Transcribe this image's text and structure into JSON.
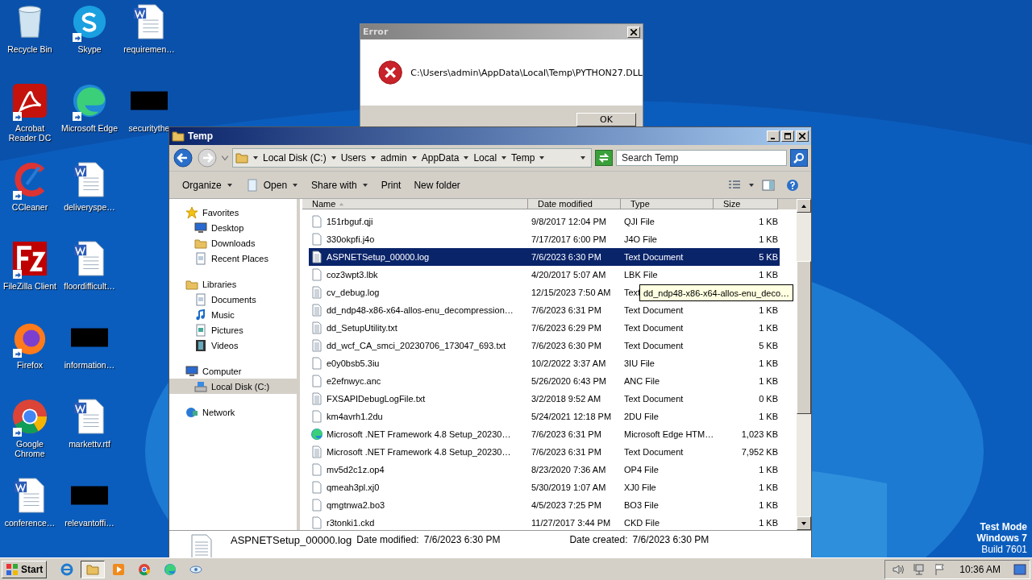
{
  "desktop_icons": [
    {
      "label": "Recycle Bin",
      "kind": "recycle",
      "shortcut": false
    },
    {
      "label": "Acrobat Reader DC",
      "kind": "acrobat",
      "shortcut": true
    },
    {
      "label": "CCleaner",
      "kind": "ccleaner",
      "shortcut": true
    },
    {
      "label": "FileZilla Client",
      "kind": "filezilla",
      "shortcut": true
    },
    {
      "label": "Firefox",
      "kind": "firefox",
      "shortcut": true
    },
    {
      "label": "Google Chrome",
      "kind": "chrome",
      "shortcut": true
    },
    {
      "label": "conference…",
      "kind": "word",
      "shortcut": false
    },
    {
      "label": "Skype",
      "kind": "skype",
      "shortcut": true
    },
    {
      "label": "Microsoft Edge",
      "kind": "edge",
      "shortcut": true
    },
    {
      "label": "deliveryspe…",
      "kind": "word",
      "shortcut": false
    },
    {
      "label": "floordifficult…",
      "kind": "word",
      "shortcut": false
    },
    {
      "label": "information…",
      "kind": "blank",
      "shortcut": false
    },
    {
      "label": "markettv.rtf",
      "kind": "word",
      "shortcut": false
    },
    {
      "label": "relevantoffi…",
      "kind": "blank",
      "shortcut": false
    },
    {
      "label": "requiremen…",
      "kind": "word",
      "shortcut": false
    },
    {
      "label": "securitythe",
      "kind": "blank",
      "shortcut": false
    }
  ],
  "error_dialog": {
    "title": "Error",
    "message": "C:\\Users\\admin\\AppData\\Local\\Temp\\PYTHON27.DLL",
    "button": "OK"
  },
  "explorer": {
    "title": "Temp",
    "breadcrumb": [
      "Local Disk (C:)",
      "Users",
      "admin",
      "AppData",
      "Local",
      "Temp"
    ],
    "search": {
      "placeholder": "Search Temp"
    },
    "toolbar": [
      {
        "label": "Organize",
        "dropdown": true
      },
      {
        "label": "Open",
        "dropdown": true
      },
      {
        "label": "Share with",
        "dropdown": true
      },
      {
        "label": "Print",
        "dropdown": false
      },
      {
        "label": "New folder",
        "dropdown": false
      }
    ],
    "nav": [
      {
        "label": "Favorites",
        "kind": "star",
        "selected": false,
        "children": [
          {
            "label": "Desktop",
            "kind": "desktop",
            "selected": false
          },
          {
            "label": "Downloads",
            "kind": "downloads",
            "selected": false
          },
          {
            "label": "Recent Places",
            "kind": "recent",
            "selected": false
          }
        ]
      },
      {
        "label": "Libraries",
        "kind": "libraries",
        "selected": false,
        "children": [
          {
            "label": "Documents",
            "kind": "documents",
            "selected": false
          },
          {
            "label": "Music",
            "kind": "music",
            "selected": false
          },
          {
            "label": "Pictures",
            "kind": "pictures",
            "selected": false
          },
          {
            "label": "Videos",
            "kind": "videos",
            "selected": false
          }
        ]
      },
      {
        "label": "Computer",
        "kind": "computer",
        "selected": false,
        "children": [
          {
            "label": "Local Disk (C:)",
            "kind": "disk",
            "selected": true
          }
        ]
      },
      {
        "label": "Network",
        "kind": "network",
        "selected": false
      }
    ],
    "columns": [
      "Name",
      "Date modified",
      "Type",
      "Size"
    ],
    "rows": [
      {
        "name": "151rbguf.qji",
        "date": "9/8/2017 12:04 PM",
        "type": "QJI File",
        "size": "1 KB",
        "kind": "file",
        "selected": false
      },
      {
        "name": "330okpfi.j4o",
        "date": "7/17/2017 6:00 PM",
        "type": "J4O File",
        "size": "1 KB",
        "kind": "file",
        "selected": false
      },
      {
        "name": "ASPNETSetup_00000.log",
        "date": "7/6/2023 6:30 PM",
        "type": "Text Document",
        "size": "5 KB",
        "kind": "text",
        "selected": true
      },
      {
        "name": "coz3wpt3.lbk",
        "date": "4/20/2017 5:07 AM",
        "type": "LBK File",
        "size": "1 KB",
        "kind": "file",
        "selected": false
      },
      {
        "name": "cv_debug.log",
        "date": "12/15/2023 7:50 AM",
        "type": "Text",
        "kind": "text",
        "selected": false
      },
      {
        "name": "dd_ndp48-x86-x64-allos-enu_decompression…",
        "date": "7/6/2023 6:31 PM",
        "type": "Text Document",
        "size": "1 KB",
        "kind": "text",
        "selected": false
      },
      {
        "name": "dd_SetupUtility.txt",
        "date": "7/6/2023 6:29 PM",
        "type": "Text Document",
        "size": "1 KB",
        "kind": "text",
        "selected": false
      },
      {
        "name": "dd_wcf_CA_smci_20230706_173047_693.txt",
        "date": "7/6/2023 6:30 PM",
        "type": "Text Document",
        "size": "5 KB",
        "kind": "text",
        "selected": false
      },
      {
        "name": "e0y0bsb5.3iu",
        "date": "10/2/2022 3:37 AM",
        "type": "3IU File",
        "size": "1 KB",
        "kind": "file",
        "selected": false
      },
      {
        "name": "e2efnwyc.anc",
        "date": "5/26/2020 6:43 PM",
        "type": "ANC File",
        "size": "1 KB",
        "kind": "file",
        "selected": false
      },
      {
        "name": "FXSAPIDebugLogFile.txt",
        "date": "3/2/2018 9:52 AM",
        "type": "Text Document",
        "size": "0 KB",
        "kind": "text",
        "selected": false
      },
      {
        "name": "km4avrh1.2du",
        "date": "5/24/2021 12:18 PM",
        "type": "2DU File",
        "size": "1 KB",
        "kind": "file",
        "selected": false
      },
      {
        "name": "Microsoft .NET Framework 4.8 Setup_20230…",
        "date": "7/6/2023 6:31 PM",
        "type": "Microsoft Edge HTM…",
        "size": "1,023 KB",
        "kind": "edge",
        "selected": false
      },
      {
        "name": "Microsoft .NET Framework 4.8 Setup_20230…",
        "date": "7/6/2023 6:31 PM",
        "type": "Text Document",
        "size": "7,952 KB",
        "kind": "text",
        "selected": false
      },
      {
        "name": "mv5d2c1z.op4",
        "date": "8/23/2020 7:36 AM",
        "type": "OP4 File",
        "size": "1 KB",
        "kind": "file",
        "selected": false
      },
      {
        "name": "qmeah3pl.xj0",
        "date": "5/30/2019 1:07 AM",
        "type": "XJ0 File",
        "size": "1 KB",
        "kind": "file",
        "selected": false
      },
      {
        "name": "qmgtnwa2.bo3",
        "date": "4/5/2023 7:25 PM",
        "type": "BO3 File",
        "size": "1 KB",
        "kind": "file",
        "selected": false
      },
      {
        "name": "r3tonki1.ckd",
        "date": "11/27/2017 3:44 PM",
        "type": "CKD File",
        "size": "1 KB",
        "kind": "file",
        "selected": false
      }
    ],
    "tooltip": "dd_ndp48-x86-x64-allos-enu_deco…",
    "details": {
      "name": "ASPNETSetup_00000.log",
      "modified_label": "Date modified:",
      "modified": "7/6/2023 6:30 PM",
      "created_label": "Date created:",
      "created": "7/6/2023 6:30 PM"
    }
  },
  "watermark": [
    "Test Mode",
    "Windows 7",
    "Build 7601"
  ],
  "taskbar": {
    "start": "Start",
    "items": [
      {
        "kind": "ie",
        "selected": false
      },
      {
        "kind": "explorer",
        "selected": true
      },
      {
        "kind": "media",
        "selected": false
      },
      {
        "kind": "chrome",
        "selected": false
      },
      {
        "kind": "edge",
        "selected": false
      },
      {
        "kind": "eye",
        "selected": false
      }
    ],
    "clock": "10:36 AM"
  }
}
